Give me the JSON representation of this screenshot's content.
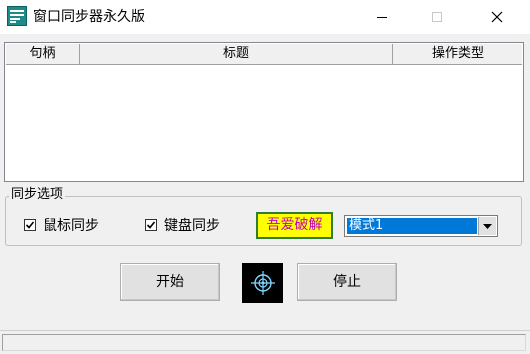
{
  "window": {
    "title": "窗口同步器永久版",
    "icon": "app-window-icon",
    "controls": {
      "minimize": "minimize-icon",
      "maximize": "maximize-icon",
      "close": "close-icon"
    }
  },
  "list": {
    "columns": [
      "句柄",
      "标题",
      "操作类型"
    ],
    "rows": []
  },
  "options": {
    "legend": "同步选项",
    "mouse_sync": {
      "label": "鼠标同步",
      "checked": true
    },
    "keyboard_sync": {
      "label": "键盘同步",
      "checked": true
    },
    "crack_label": "吾爱破解",
    "mode": {
      "selected": "模式1"
    }
  },
  "buttons": {
    "start": "开始",
    "stop": "停止",
    "logo_icon": "crosshair-logo-icon"
  },
  "colors": {
    "crack_bg": "#ffff00",
    "crack_text": "#c000c0",
    "crack_border": "#2e7d32",
    "select_highlight": "#0078d7"
  }
}
